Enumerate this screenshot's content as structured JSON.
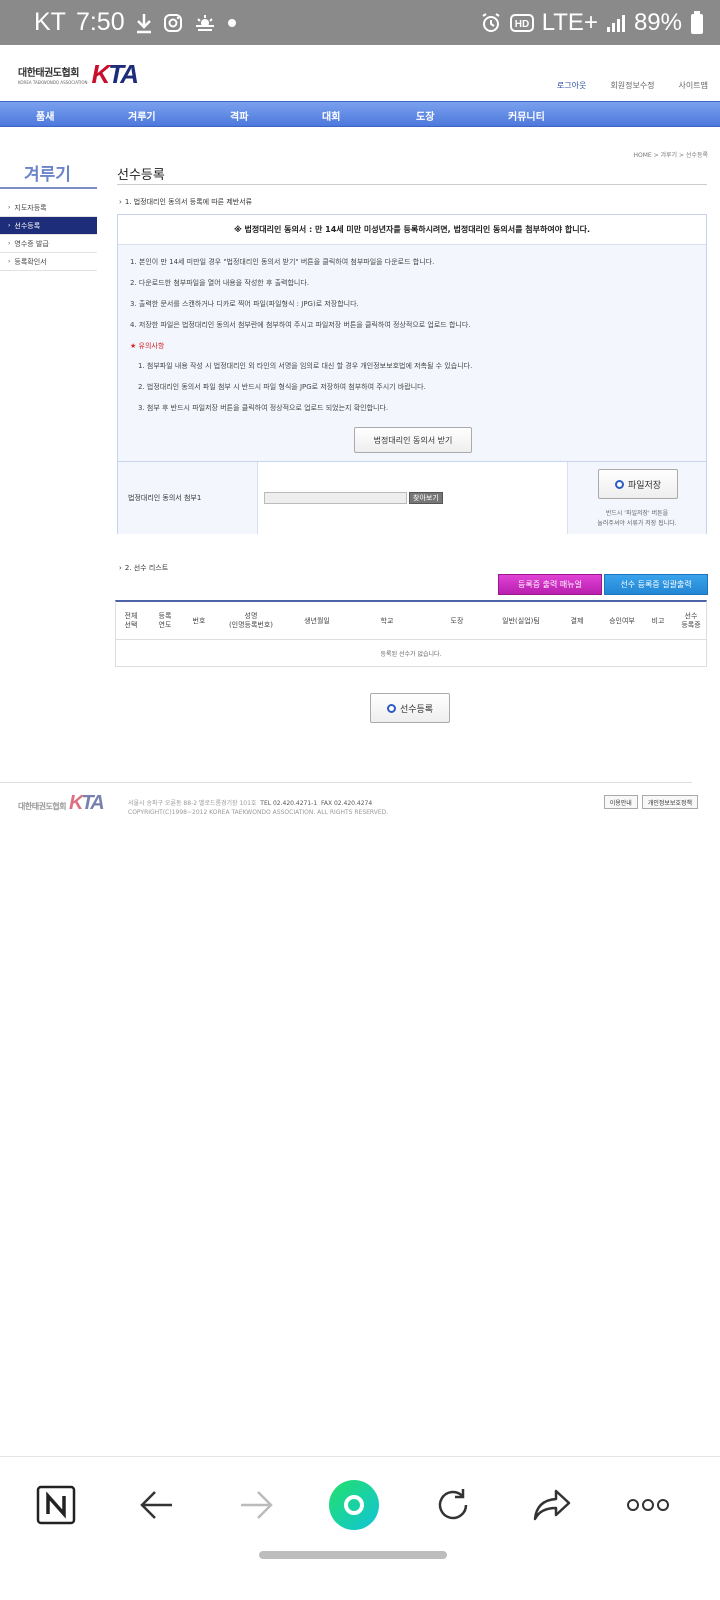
{
  "status_bar": {
    "carrier": "KT",
    "time": "7:50",
    "network": "LTE+",
    "battery": "89%"
  },
  "header": {
    "logo_korean": "대한태권도협회",
    "logo_english": "KOREA TAEKWONDO ASSOCIATION",
    "logo_mark_k": "K",
    "logo_mark_rest": "TA",
    "top_links": [
      "로그아웃",
      "회원정보수정",
      "사이트맵"
    ]
  },
  "nav": {
    "items": [
      "품새",
      "겨루기",
      "격파",
      "대회",
      "도장",
      "커뮤니티"
    ]
  },
  "sidebar": {
    "title": "겨루기",
    "items": [
      {
        "label": "지도자등록",
        "active": false
      },
      {
        "label": "선수등록",
        "active": true
      },
      {
        "label": "영수증 발급",
        "active": false
      },
      {
        "label": "등록확인서",
        "active": false
      }
    ]
  },
  "main": {
    "breadcrumb": "HOME > 겨루기 > 선수등록",
    "title": "선수등록",
    "section1_label": "1. 법정대리인 동의서 등록에 따른 제반서류",
    "notice_head": "※ 법정대리인 동의서 : 만 14세 미만 미성년자를 등록하시려면, 법정대리인 동의서를 첨부하여야 합니다.",
    "notice_lines": [
      "1. 본인이 만 14세 미만일 경우 \"법정대리인 동의서 받기\" 버튼을 클릭하여 첨부파일을 다운로드 합니다.",
      "2. 다운로드한 첨부파일을 열어 내용을 작성한 후 출력합니다.",
      "3. 출력한 문서를 스캔하거나 디카로 찍어 파일(파일형식 : JPG)로 저장합니다.",
      "4. 저장한 파일은 법정대리인 동의서 첨부란에 첨부하여 주시고 파일저장 버튼을 클릭하여 정상적으로 업로드 합니다."
    ],
    "caution_head": "★ 유의사항",
    "caution_lines": [
      "1. 첨부파일 내용 작성 시 법정대리인 외 타인의 서명을 임의로 대신 할 경우 개인정보보호법에 저촉될 수 있습니다.",
      "2. 법정대리인 동의서 파일 첨부 시 반드시 파일 형식을 JPG로 저장하여 첨부하여 주시기 바랍니다.",
      "3. 첨부 후 반드시 파일저장 버튼을 클릭하여 정상적으로 업로드 되었는지 확인합니다."
    ],
    "consent_button": "법정대리인 동의서 받기",
    "attach_label": "법정대리인 동의서 첨부1",
    "find_button": "찾아보기",
    "save_button": "파일저장",
    "save_note_1": "반드시 '파일저장' 버튼을",
    "save_note_2": "눌러주셔야 서류가 저장 됩니다.",
    "section2_label": "2. 선수 리스트",
    "manual_button": "등록증 출력 매뉴얼",
    "print_all_button": "선수 등록증 일괄출력",
    "table_headers": [
      "전체\n선택",
      "등록\n연도",
      "번호",
      "성명\n(인명등록번호)",
      "생년월일",
      "학교",
      "도장",
      "일반(실업)팀",
      "결제",
      "승인여부",
      "비고",
      "선수\n등록증"
    ],
    "empty_message": "등록된 선수가 없습니다.",
    "register_button": "선수등록"
  },
  "footer": {
    "logo_korean": "대한태권도협회",
    "address": "서울시 송파구 오륜동 88-2 벨로드롬경기장 101호",
    "tel": "TEL 02.420.4271-1",
    "fax": "FAX 02.420.4274",
    "copyright": "COPYRIGHT(C)1998~2012 KOREA TAEKWONDO ASSOCIATION. ALL RIGHTS RESERVED.",
    "buttons": [
      "이용안내",
      "개인정보보호정책"
    ]
  },
  "browser_bar": {
    "icons": [
      "naver-icon",
      "back-icon",
      "forward-icon",
      "home-icon",
      "refresh-icon",
      "share-icon",
      "more-icon"
    ]
  },
  "colors": {
    "nav_blue": "#4d78dc",
    "sidebar_active": "#1e2d7a",
    "manual_magenta": "#c72ac0",
    "print_blue": "#2a8fdc",
    "logo_red": "#c8102e",
    "home_green": "#1fd39c"
  }
}
